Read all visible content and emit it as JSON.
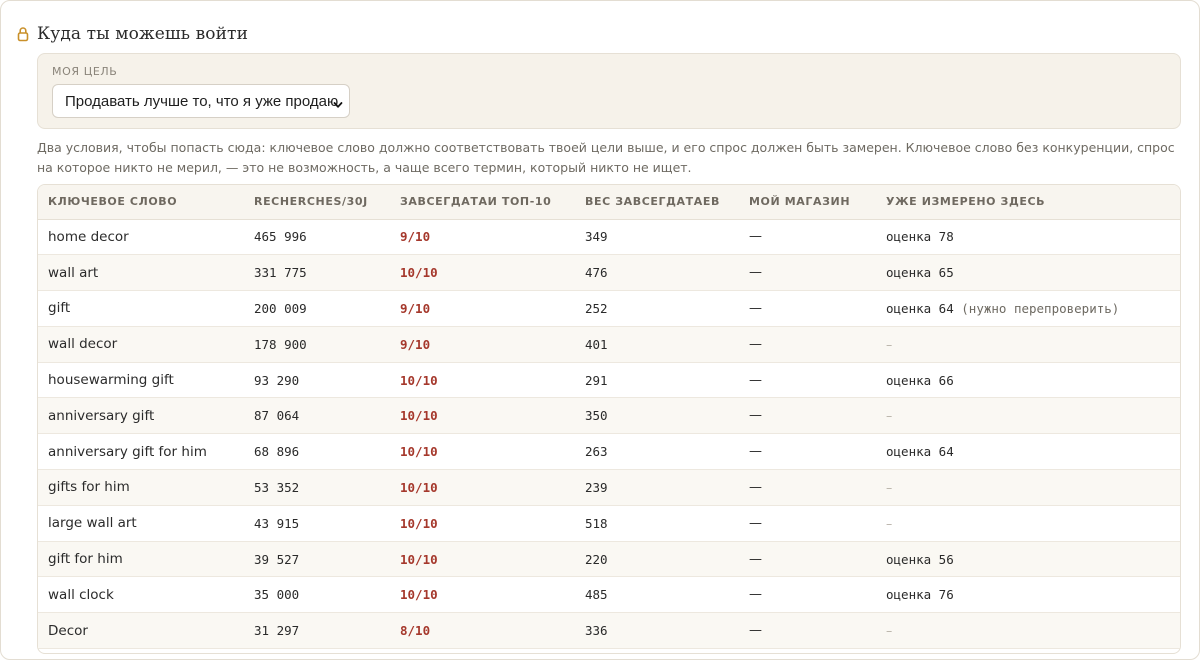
{
  "section": {
    "title": "Куда ты можешь войти",
    "icon": "lock-icon"
  },
  "goal": {
    "label": "МОЯ ЦЕЛЬ",
    "selected": "Продавать лучше то, что я уже продаю"
  },
  "hint": "Два условия, чтобы попасть сюда: ключевое слово должно соответствовать твоей цели выше, и его спрос должен быть замерен. Ключевое слово без конкуренции, спрос на которое никто не мерил, — это не возможность, а чаще всего термин, который никто не ищет.",
  "colors": {
    "accent_red": "#a5382c",
    "lock": "#c9902a"
  },
  "table": {
    "headers": [
      "КЛЮЧЕВОЕ СЛОВО",
      "RECHERCHES/30J",
      "ЗАВСЕГДАТАИ ТОП-10",
      "ВЕС ЗАВСЕГДАТАЕВ",
      "МОЙ МАГАЗИН",
      "УЖЕ ИЗМЕРЕНО ЗДЕСЬ"
    ],
    "rows": [
      {
        "keyword": "home decor",
        "searches": "465 996",
        "regulars": "9/10",
        "weight": "349",
        "shop": "—",
        "measured": "оценка 78",
        "note": ""
      },
      {
        "keyword": "wall art",
        "searches": "331 775",
        "regulars": "10/10",
        "weight": "476",
        "shop": "—",
        "measured": "оценка 65",
        "note": ""
      },
      {
        "keyword": "gift",
        "searches": "200 009",
        "regulars": "9/10",
        "weight": "252",
        "shop": "—",
        "measured": "оценка 64",
        "note": "(нужно перепроверить)"
      },
      {
        "keyword": "wall decor",
        "searches": "178 900",
        "regulars": "9/10",
        "weight": "401",
        "shop": "—",
        "measured": "",
        "note": ""
      },
      {
        "keyword": "housewarming gift",
        "searches": "93 290",
        "regulars": "10/10",
        "weight": "291",
        "shop": "—",
        "measured": "оценка 66",
        "note": ""
      },
      {
        "keyword": "anniversary gift",
        "searches": "87 064",
        "regulars": "10/10",
        "weight": "350",
        "shop": "—",
        "measured": "",
        "note": ""
      },
      {
        "keyword": "anniversary gift for him",
        "searches": "68 896",
        "regulars": "10/10",
        "weight": "263",
        "shop": "—",
        "measured": "оценка 64",
        "note": ""
      },
      {
        "keyword": "gifts for him",
        "searches": "53 352",
        "regulars": "10/10",
        "weight": "239",
        "shop": "—",
        "measured": "",
        "note": ""
      },
      {
        "keyword": "large wall art",
        "searches": "43 915",
        "regulars": "10/10",
        "weight": "518",
        "shop": "—",
        "measured": "",
        "note": ""
      },
      {
        "keyword": "gift for him",
        "searches": "39 527",
        "regulars": "10/10",
        "weight": "220",
        "shop": "—",
        "measured": "оценка 56",
        "note": ""
      },
      {
        "keyword": "wall clock",
        "searches": "35 000",
        "regulars": "10/10",
        "weight": "485",
        "shop": "—",
        "measured": "оценка 76",
        "note": ""
      },
      {
        "keyword": "Decor",
        "searches": "31 297",
        "regulars": "8/10",
        "weight": "336",
        "shop": "—",
        "measured": "",
        "note": ""
      }
    ],
    "empty_mark": "–"
  }
}
